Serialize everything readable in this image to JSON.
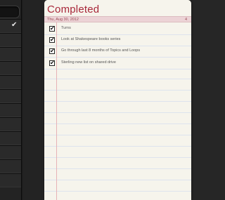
{
  "sidebar": {
    "rows": [
      {
        "checked": "✔"
      },
      {
        "checked": ""
      },
      {
        "checked": ""
      },
      {
        "checked": ""
      },
      {
        "checked": ""
      },
      {
        "checked": ""
      },
      {
        "checked": ""
      },
      {
        "checked": ""
      },
      {
        "checked": ""
      },
      {
        "checked": ""
      },
      {
        "checked": ""
      },
      {
        "checked": ""
      }
    ]
  },
  "list": {
    "title": "Completed",
    "date": "Thu, Aug 30, 2012",
    "count": "4",
    "tasks": [
      {
        "label": "Turns",
        "check": "✔"
      },
      {
        "label": "Look at Shakespeare books series",
        "check": "✔"
      },
      {
        "label": "Go through last 8 months of Topics and Loops",
        "check": "✔"
      },
      {
        "label": "Sterling new list on shared drive",
        "check": "✔"
      }
    ]
  },
  "colors": {
    "title": "#a8283a",
    "paper": "#f6f4ec",
    "date_bar": "#ecd3d6",
    "margin_line": "#e7b2b6",
    "sidebar": "#232323"
  }
}
